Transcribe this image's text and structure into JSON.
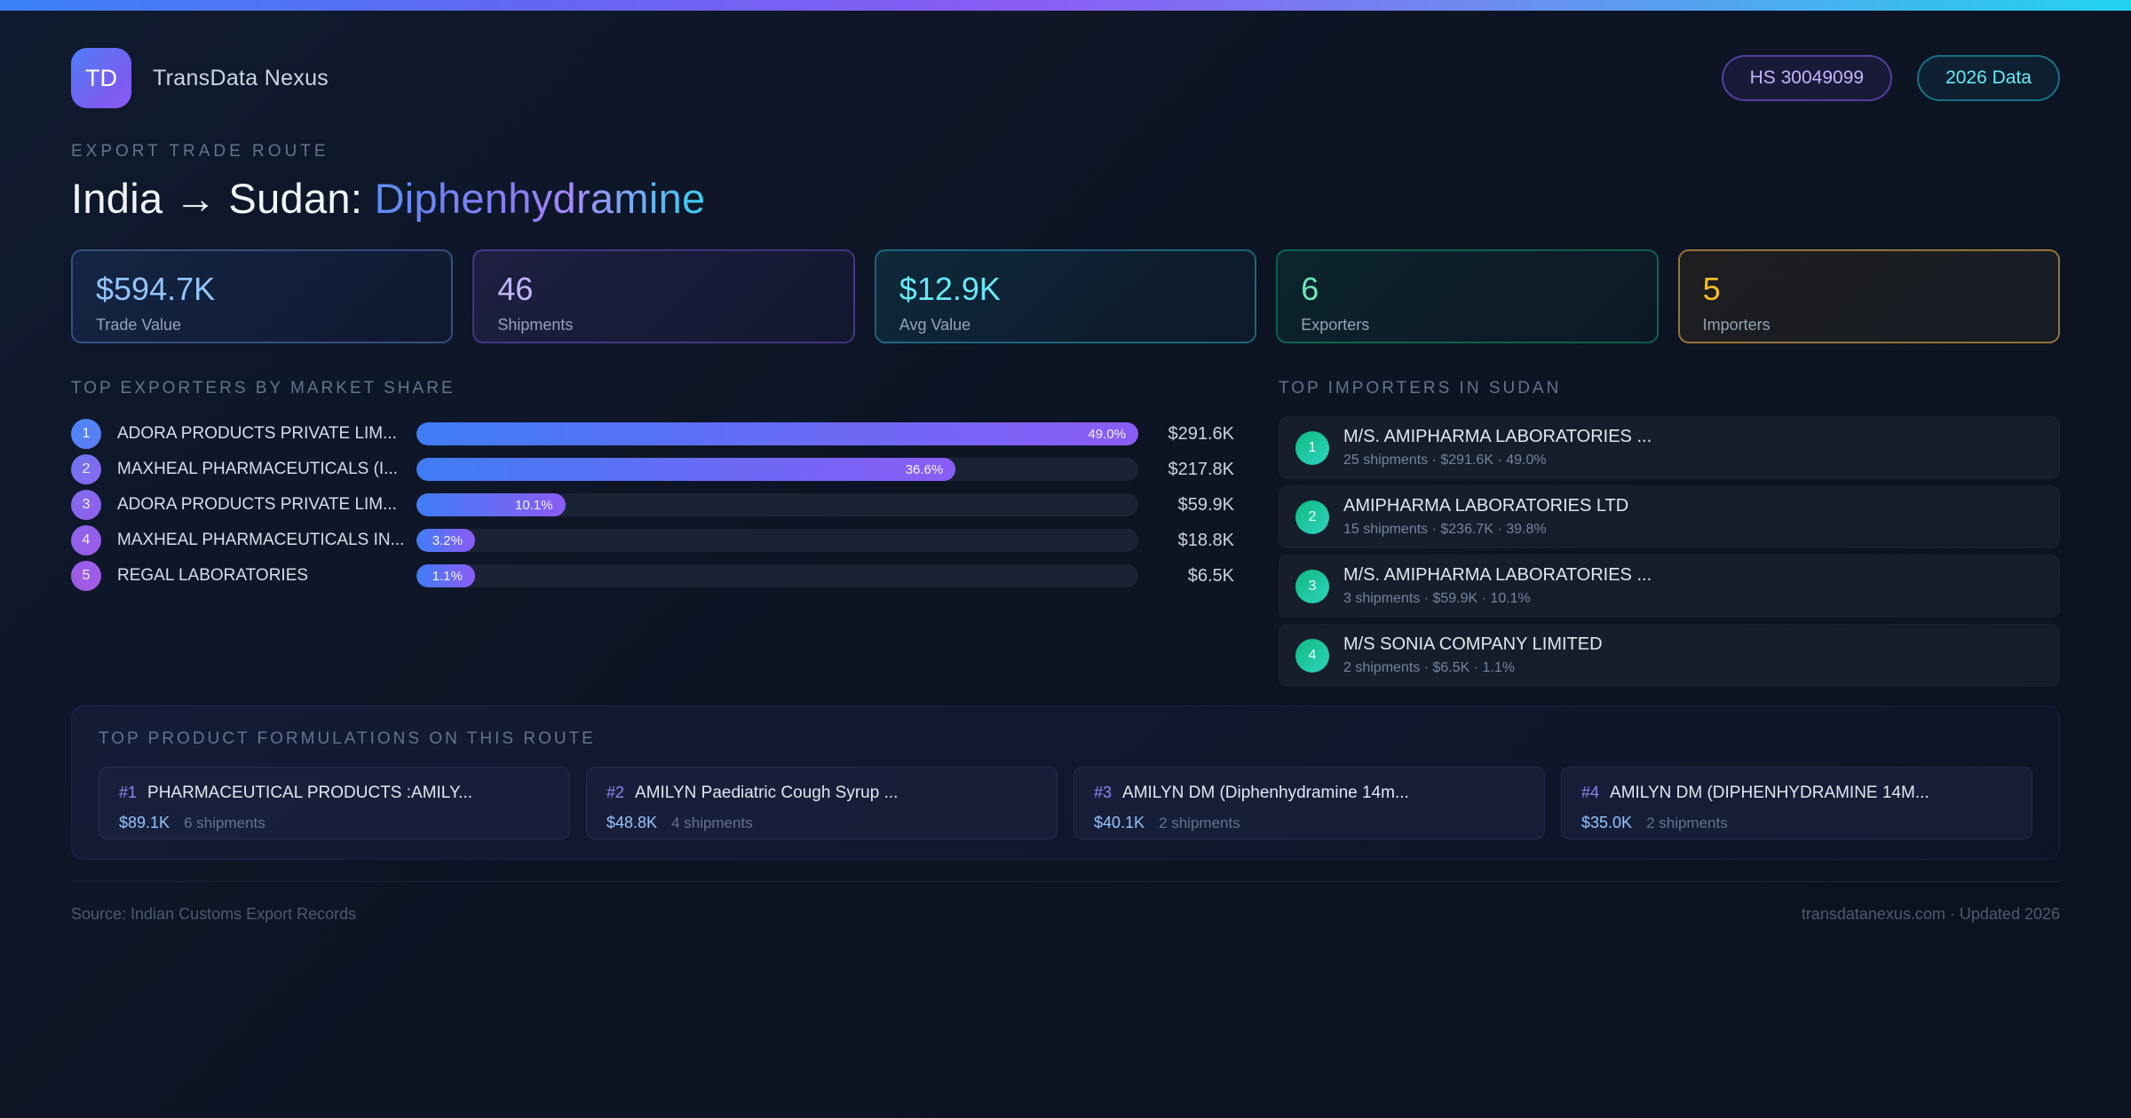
{
  "colors": {
    "accent_blue": "#3b82f6",
    "accent_purple": "#8b5cf6",
    "accent_cyan": "#22d3ee",
    "accent_green": "#10b981",
    "accent_amber": "#f59e0b",
    "background": "#0d1424"
  },
  "header": {
    "logo_text": "TD",
    "brand": "TransData Nexus",
    "badge_hs": "HS 30049099",
    "badge_year": "2026 Data"
  },
  "hero": {
    "eyebrow": "EXPORT TRADE ROUTE",
    "route": "India → Sudan: ",
    "product": "Diphenhydramine"
  },
  "stats": [
    {
      "value": "$594.7K",
      "label": "Trade Value"
    },
    {
      "value": "46",
      "label": "Shipments"
    },
    {
      "value": "$12.9K",
      "label": "Avg Value"
    },
    {
      "value": "6",
      "label": "Exporters"
    },
    {
      "value": "5",
      "label": "Importers"
    }
  ],
  "exporters": {
    "heading": "TOP EXPORTERS BY MARKET SHARE",
    "items": [
      {
        "rank": "1",
        "name": "ADORA PRODUCTS PRIVATE LIM...",
        "share_pct": 49.0,
        "share_label": "49.0%",
        "value": "$291.6K"
      },
      {
        "rank": "2",
        "name": "MAXHEAL PHARMACEUTICALS (I...",
        "share_pct": 36.6,
        "share_label": "36.6%",
        "value": "$217.8K"
      },
      {
        "rank": "3",
        "name": "ADORA PRODUCTS PRIVATE LIM...",
        "share_pct": 10.1,
        "share_label": "10.1%",
        "value": "$59.9K"
      },
      {
        "rank": "4",
        "name": "MAXHEAL PHARMACEUTICALS IN...",
        "share_pct": 3.2,
        "share_label": "3.2%",
        "value": "$18.8K"
      },
      {
        "rank": "5",
        "name": "REGAL LABORATORIES",
        "share_pct": 1.1,
        "share_label": "1.1%",
        "value": "$6.5K"
      }
    ]
  },
  "importers": {
    "heading": "TOP IMPORTERS IN SUDAN",
    "items": [
      {
        "rank": "1",
        "name": "M/S. AMIPHARMA LABORATORIES ...",
        "meta": "25 shipments · $291.6K · 49.0%"
      },
      {
        "rank": "2",
        "name": "AMIPHARMA LABORATORIES LTD",
        "meta": "15 shipments · $236.7K · 39.8%"
      },
      {
        "rank": "3",
        "name": "M/S. AMIPHARMA LABORATORIES ...",
        "meta": "3 shipments · $59.9K · 10.1%"
      },
      {
        "rank": "4",
        "name": "M/S SONIA COMPANY LIMITED",
        "meta": "2 shipments · $6.5K · 1.1%"
      }
    ]
  },
  "products": {
    "heading": "TOP PRODUCT FORMULATIONS ON THIS ROUTE",
    "items": [
      {
        "rank": "#1",
        "name": "PHARMACEUTICAL PRODUCTS :AMILY...",
        "value": "$89.1K",
        "shipments": "6 shipments"
      },
      {
        "rank": "#2",
        "name": "AMILYN Paediatric Cough Syrup ...",
        "value": "$48.8K",
        "shipments": "4 shipments"
      },
      {
        "rank": "#3",
        "name": "AMILYN DM (Diphenhydramine 14m...",
        "value": "$40.1K",
        "shipments": "2 shipments"
      },
      {
        "rank": "#4",
        "name": "AMILYN DM (DIPHENHYDRAMINE 14M...",
        "value": "$35.0K",
        "shipments": "2 shipments"
      }
    ]
  },
  "footer": {
    "source": "Source: Indian Customs Export Records",
    "site": "transdatanexus.com · Updated 2026"
  }
}
